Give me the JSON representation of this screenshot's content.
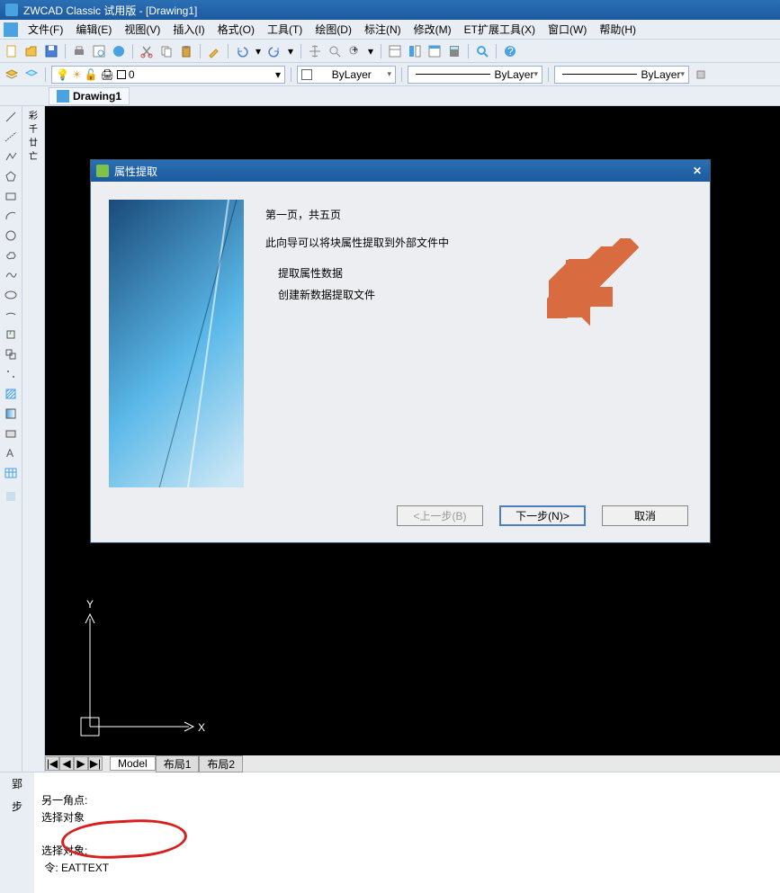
{
  "title": "ZWCAD Classic 试用版 - [Drawing1]",
  "menu": [
    "文件(F)",
    "编辑(E)",
    "视图(V)",
    "插入(I)",
    "格式(O)",
    "工具(T)",
    "绘图(D)",
    "标注(N)",
    "修改(M)",
    "ET扩展工具(X)",
    "窗口(W)",
    "帮助(H)"
  ],
  "doc_tab": "Drawing1",
  "layer_name": "0",
  "combo1": "ByLayer",
  "combo2": "ByLayer",
  "combo3": "ByLayer",
  "layout_tabs": {
    "nav": [
      "|◀",
      "◀",
      "▶",
      "▶|"
    ],
    "model": "Model",
    "l1": "布局1",
    "l2": "布局2"
  },
  "cmd": {
    "line1": "另一角点:",
    "line2": "选择对象",
    "line3": "选择对象:",
    "line4": " 令: EATTEXT"
  },
  "dialog": {
    "title": "属性提取",
    "page": "第一页，共五页",
    "desc": "此向导可以将块属性提取到外部文件中",
    "opt1": "提取属性数据",
    "opt2": "创建新数据提取文件",
    "back": "<上一步(B)",
    "next": "下一步(N)>",
    "cancel": "取消"
  }
}
